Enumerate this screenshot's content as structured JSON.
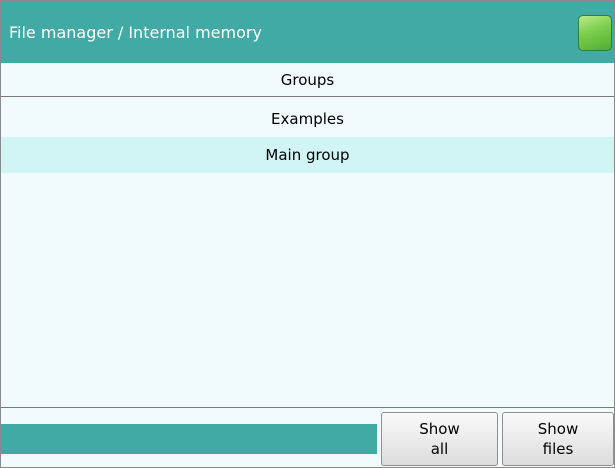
{
  "header": {
    "title": "File manager / Internal memory",
    "status_icon": "green-status-indicator"
  },
  "list": {
    "column_header": "Groups",
    "items": [
      {
        "label": "Examples",
        "selected": false
      },
      {
        "label": "Main group",
        "selected": true
      }
    ]
  },
  "footer": {
    "buttons": [
      {
        "line1": "Show",
        "line2": "all"
      },
      {
        "line1": "Show",
        "line2": "files"
      }
    ]
  },
  "colors": {
    "accent": "#41aaa5",
    "selected_row": "#d1f4f4",
    "background": "#f1fafc",
    "status_green": "#7bcd4c"
  }
}
